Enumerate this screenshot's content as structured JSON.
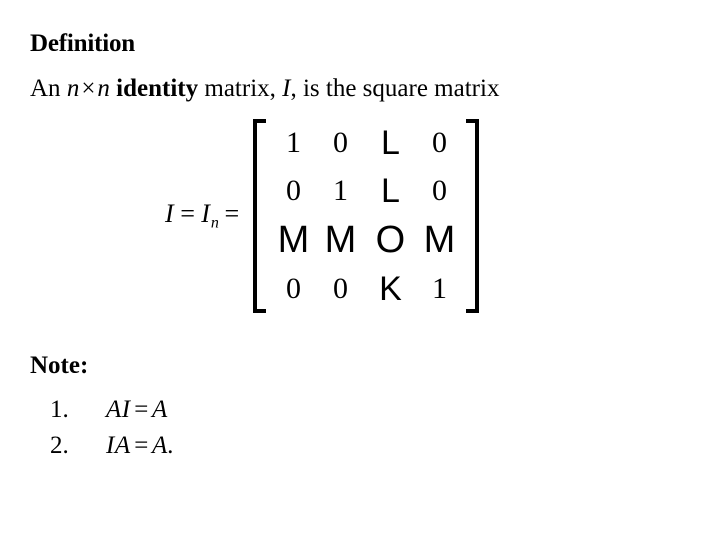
{
  "slide": {
    "background_color": "#ffffff",
    "text_color": "#000000",
    "heading_definition": "Definition",
    "heading_note": "Note:"
  },
  "definition": {
    "text_full": "An n × n identity matrix, I, is the square matrix",
    "part_1": "An ",
    "var_n_1": "n",
    "times_symbol": "×",
    "var_n_2": "n",
    "emphasis": "identity",
    "part_2": " matrix, ",
    "var_I": "I",
    "part_3": ", is the square matrix"
  },
  "equation": {
    "lhs_I": "I",
    "equals_1": "=",
    "lhs_I_sub": "I",
    "lhs_subscript": "n",
    "equals_2": "=",
    "matrix": {
      "rows": 4,
      "cols": 4,
      "cells": [
        [
          {
            "text": "1",
            "kind": "num"
          },
          {
            "text": "0",
            "kind": "num"
          },
          {
            "text": "L",
            "kind": "sym"
          },
          {
            "text": "0",
            "kind": "num"
          }
        ],
        [
          {
            "text": "0",
            "kind": "num"
          },
          {
            "text": "1",
            "kind": "num"
          },
          {
            "text": "L",
            "kind": "sym"
          },
          {
            "text": "0",
            "kind": "num"
          }
        ],
        [
          {
            "text": "M",
            "kind": "sym-big"
          },
          {
            "text": "M",
            "kind": "sym-big"
          },
          {
            "text": "O",
            "kind": "sym-big"
          },
          {
            "text": "M",
            "kind": "sym-big"
          }
        ],
        [
          {
            "text": "0",
            "kind": "num"
          },
          {
            "text": "0",
            "kind": "num"
          },
          {
            "text": "K",
            "kind": "sym"
          },
          {
            "text": "1",
            "kind": "num"
          }
        ]
      ]
    }
  },
  "notes": [
    {
      "marker": "1.",
      "text_lhs": "AI",
      "equals": "=",
      "text_rhs": "A"
    },
    {
      "marker": "2.",
      "text_lhs": "IA",
      "equals": "=",
      "text_rhs": "A."
    }
  ]
}
